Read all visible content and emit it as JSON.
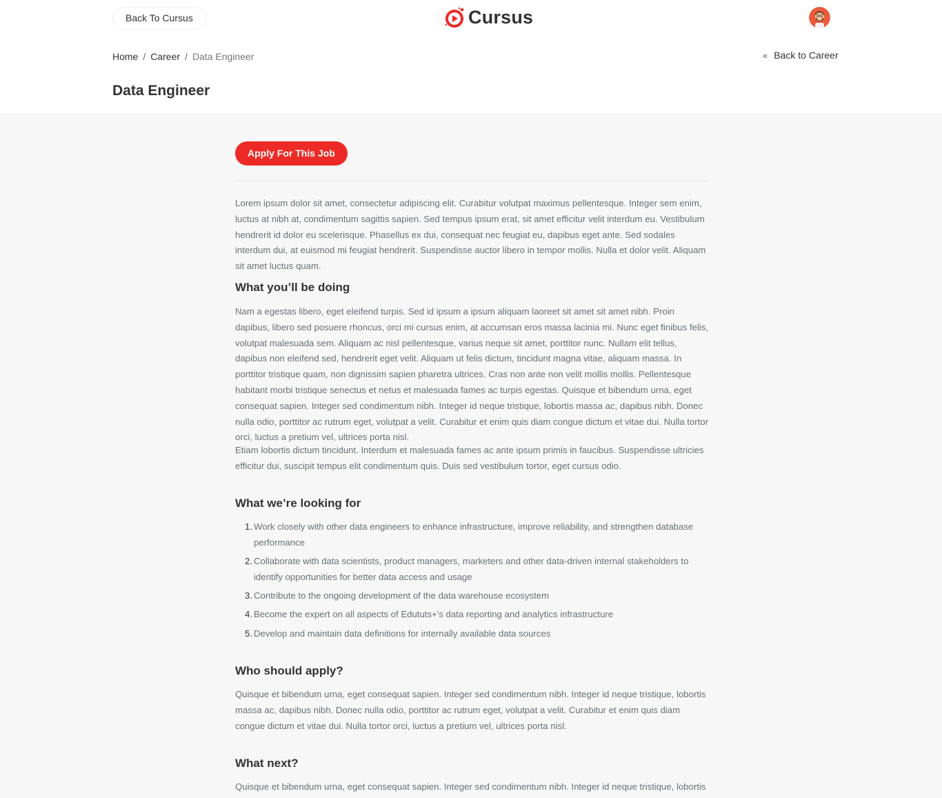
{
  "topbar": {
    "back_label": "Back To Cursus",
    "logo_text": "Cursus",
    "brand_color": "#ed2a26"
  },
  "breadcrumb": {
    "items": [
      "Home",
      "Career",
      "Data Engineer"
    ],
    "separator": "/"
  },
  "back_link": {
    "icon": "«",
    "label": "Back to Career"
  },
  "page": {
    "title": "Data Engineer"
  },
  "job": {
    "apply_label": "Apply For This Job",
    "intro": "Lorem ipsum dolor sit amet, consectetur adipiscing elit. Curabitur volutpat maximus pellentesque. Integer sem enim, luctus at nibh at, condimentum sagittis sapien. Sed tempus ipsum erat, sit amet efficitur velit interdum eu. Vestibulum hendrerit id dolor eu scelerisque. Phasellus ex dui, consequat nec feugiat eu, dapibus eget ante. Sed sodales interdum dui, at euismod mi feugiat hendrerit. Suspendisse auctor libero in tempor mollis. Nulla et dolor velit. Aliquam sit amet luctus quam.",
    "doing": {
      "heading": "What you’ll be doing",
      "paragraphs": [
        "Nam a egestas libero, eget eleifend turpis. Sed id ipsum a ipsum aliquam laoreet sit amet sit amet nibh. Proin dapibus, libero sed posuere rhoncus, orci mi cursus enim, at accumsan eros massa lacinia mi. Nunc eget finibus felis, volutpat malesuada sem. Aliquam ac nisl pellentesque, varius neque sit amet, porttitor nunc. Nullam elit tellus, dapibus non eleifend sed, hendrerit eget velit. Aliquam ut felis dictum, tincidunt magna vitae, aliquam massa. In porttitor tristique quam, non dignissim sapien pharetra ultrices. Cras non ante non velit mollis mollis. Pellentesque habitant morbi tristique senectus et netus et malesuada fames ac turpis egestas. Quisque et bibendum urna, eget consequat sapien. Integer sed condimentum nibh. Integer id neque tristique, lobortis massa ac, dapibus nibh. Donec nulla odio, porttitor ac rutrum eget, volutpat a velit. Curabitur et enim quis diam congue dictum et vitae dui. Nulla tortor orci, luctus a pretium vel, ultrices porta nisl.",
        "Etiam lobortis dictum tincidunt. Interdum et malesuada fames ac ante ipsum primis in faucibus. Suspendisse ultricies efficitur dui, suscipit tempus elit condimentum quis. Duis sed vestibulum tortor, eget cursus odio."
      ]
    },
    "looking": {
      "heading": "What we’re looking for",
      "items": [
        {
          "num": "1.",
          "text": "Work closely with other data engineers to enhance infrastructure, improve reliability, and strengthen database performance"
        },
        {
          "num": "2.",
          "text": "Collaborate with data scientists, product managers, marketers and other data-driven internal stakeholders to identify opportunities for better data access and usage"
        },
        {
          "num": "3.",
          "text": "Contribute to the ongoing development of the data warehouse ecosystem"
        },
        {
          "num": "4.",
          "text": "Become the expert on all aspects of Edututs+'s data reporting and analytics infrastructure"
        },
        {
          "num": "5.",
          "text": "Develop and maintain data definitions for internally available data sources"
        }
      ]
    },
    "who": {
      "heading": "Who should apply?",
      "text": "Quisque et bibendum urna, eget consequat sapien. Integer sed condimentum nibh. Integer id neque tristique, lobortis massa ac, dapibus nibh. Donec nulla odio, porttitor ac rutrum eget, volutpat a velit. Curabitur et enim quis diam congue dictum et vitae dui. Nulla tortor orci, luctus a pretium vel, ultrices porta nisl."
    },
    "next": {
      "heading": "What next?",
      "text": "Quisque et bibendum urna, eget consequat sapien. Integer sed condimentum nibh. Integer id neque tristique, lobortis massa"
    }
  }
}
